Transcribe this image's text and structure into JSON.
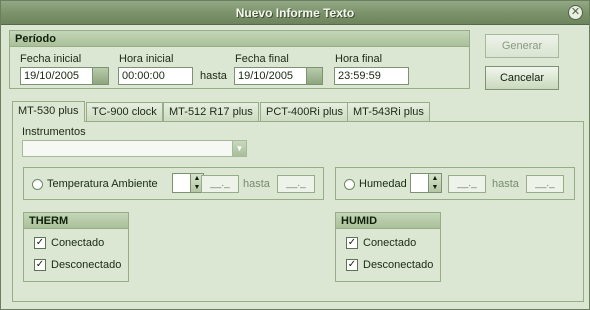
{
  "window": {
    "title": "Nuevo Informe Texto"
  },
  "periodo": {
    "title": "Período",
    "fecha_inicial_label": "Fecha inicial",
    "fecha_inicial_value": "19/10/2005",
    "hora_inicial_label": "Hora inicial",
    "hora_inicial_value": "00:00:00",
    "hasta_label": "hasta",
    "fecha_final_label": "Fecha final",
    "fecha_final_value": "19/10/2005",
    "hora_final_label": "Hora final",
    "hora_final_value": "23:59:59"
  },
  "buttons": {
    "generar": "Generar",
    "cancelar": "Cancelar"
  },
  "tabs": [
    {
      "label": "MT-530 plus",
      "active": true
    },
    {
      "label": "TC-900 clock"
    },
    {
      "label": "MT-512 R17 plus"
    },
    {
      "label": "PCT-400Ri plus"
    },
    {
      "label": "MT-543Ri plus"
    }
  ],
  "panel": {
    "instrumentos_label": "Instrumentos",
    "instrumentos_value": "",
    "temperatura": {
      "label": "Temperatura Ambiente",
      "from": "__._",
      "hasta": "hasta",
      "to": "__._"
    },
    "humedad": {
      "label": "Humedad",
      "from": "__._",
      "hasta": "hasta",
      "to": "__._"
    },
    "therm": {
      "title": "THERM",
      "conectado": "Conectado",
      "desconectado": "Desconectado"
    },
    "humid": {
      "title": "HUMID",
      "conectado": "Conectado",
      "desconectado": "Desconectado"
    }
  },
  "icons": {
    "close": "close-icon",
    "calendar": "calendar-icon",
    "dropdown": "chevron-down-icon",
    "spinner": "spinner-icon",
    "check": "checkmark-icon"
  }
}
